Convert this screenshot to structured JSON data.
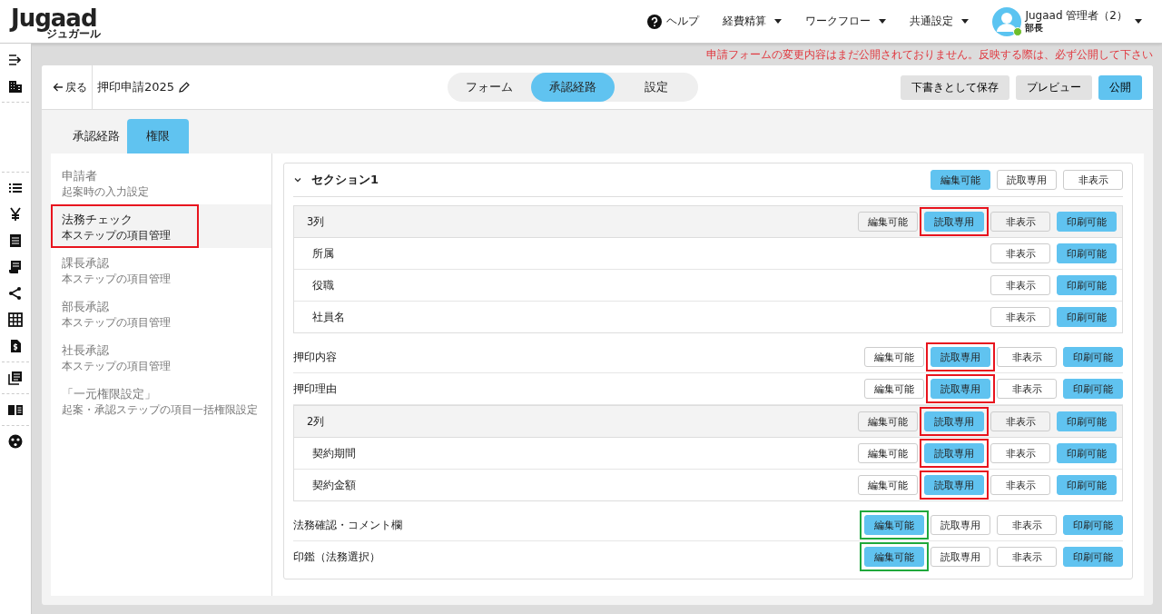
{
  "header": {
    "logo": "Jugaad",
    "logo_sub": "ジュガール",
    "help": "ヘルプ",
    "menus": [
      "経費精算",
      "ワークフロー",
      "共通設定"
    ],
    "user_name": "Jugaad 管理者（2）",
    "user_role": "部長",
    "online": true
  },
  "notice": "申請フォームの変更内容はまだ公開されておりません。反映する際は、必ず公開して下さい",
  "toolbar": {
    "back": "戻る",
    "title": "押印申請2025",
    "segments": [
      {
        "label": "フォーム",
        "selected": false
      },
      {
        "label": "承認経路",
        "selected": true
      },
      {
        "label": "設定",
        "selected": false
      }
    ],
    "buttons": [
      {
        "label": "下書きとして保存",
        "kind": "secondary"
      },
      {
        "label": "プレビュー",
        "kind": "secondary"
      },
      {
        "label": "公開",
        "kind": "primary"
      }
    ]
  },
  "tabs": [
    {
      "label": "承認経路",
      "selected": false
    },
    {
      "label": "権限",
      "selected": true
    }
  ],
  "steps": [
    {
      "title": "申請者",
      "subtitle": "起案時の入力設定",
      "selected": false
    },
    {
      "title": "法務チェック",
      "subtitle": "本ステップの項目管理",
      "selected": true,
      "color": "#e8141e"
    },
    {
      "title": "課長承認",
      "subtitle": "本ステップの項目管理",
      "selected": false
    },
    {
      "title": "部長承認",
      "subtitle": "本ステップの項目管理",
      "selected": false
    },
    {
      "title": "社長承認",
      "subtitle": "本ステップの項目管理",
      "selected": false
    },
    {
      "title": "「一元権限設定」",
      "subtitle": "起案・承認ステップの項目一括権限設定",
      "selected": false
    }
  ],
  "section": {
    "title": "セクション1",
    "expanded": true,
    "buttons": [
      {
        "label": "編集可能",
        "selected": true
      },
      {
        "label": "読取専用",
        "selected": false
      },
      {
        "label": "非表示",
        "selected": false
      }
    ],
    "rows": [
      {
        "kind": "group",
        "label": "3列",
        "buttons": [
          {
            "label": "編集可能",
            "selected": false
          },
          {
            "label": "読取専用",
            "selected": true,
            "color": "#e8141e"
          },
          {
            "label": "非表示",
            "selected": false
          },
          {
            "label": "印刷可能",
            "selected": true
          }
        ],
        "children": [
          {
            "label": "所属",
            "buttons": [
              {
                "label": "非表示",
                "selected": false
              },
              {
                "label": "印刷可能",
                "selected": true
              }
            ]
          },
          {
            "label": "役職",
            "buttons": [
              {
                "label": "非表示",
                "selected": false
              },
              {
                "label": "印刷可能",
                "selected": true
              }
            ]
          },
          {
            "label": "社員名",
            "buttons": [
              {
                "label": "非表示",
                "selected": false
              },
              {
                "label": "印刷可能",
                "selected": true
              }
            ]
          }
        ]
      },
      {
        "kind": "field",
        "label": "押印内容",
        "buttons": [
          {
            "label": "編集可能",
            "selected": false
          },
          {
            "label": "読取専用",
            "selected": true,
            "color": "#e8141e"
          },
          {
            "label": "非表示",
            "selected": false
          },
          {
            "label": "印刷可能",
            "selected": true
          }
        ]
      },
      {
        "kind": "field",
        "label": "押印理由",
        "buttons": [
          {
            "label": "編集可能",
            "selected": false
          },
          {
            "label": "読取専用",
            "selected": true,
            "color": "#e8141e"
          },
          {
            "label": "非表示",
            "selected": false
          },
          {
            "label": "印刷可能",
            "selected": true
          }
        ]
      },
      {
        "kind": "group",
        "label": "2列",
        "buttons": [
          {
            "label": "編集可能",
            "selected": false
          },
          {
            "label": "読取専用",
            "selected": true,
            "color": "#e8141e"
          },
          {
            "label": "非表示",
            "selected": false
          },
          {
            "label": "印刷可能",
            "selected": true
          }
        ],
        "children": [
          {
            "label": "契約期間",
            "buttons": [
              {
                "label": "編集可能",
                "selected": false
              },
              {
                "label": "読取専用",
                "selected": true,
                "color": "#e8141e"
              },
              {
                "label": "非表示",
                "selected": false
              },
              {
                "label": "印刷可能",
                "selected": true
              }
            ]
          },
          {
            "label": "契約金額",
            "buttons": [
              {
                "label": "編集可能",
                "selected": false
              },
              {
                "label": "読取専用",
                "selected": true,
                "color": "#e8141e"
              },
              {
                "label": "非表示",
                "selected": false
              },
              {
                "label": "印刷可能",
                "selected": true
              }
            ]
          }
        ]
      },
      {
        "kind": "field",
        "label": "法務確認・コメント欄",
        "buttons": [
          {
            "label": "編集可能",
            "selected": true,
            "color": "#1fa83c"
          },
          {
            "label": "読取専用",
            "selected": false
          },
          {
            "label": "非表示",
            "selected": false
          },
          {
            "label": "印刷可能",
            "selected": true
          }
        ]
      },
      {
        "kind": "field",
        "label": "印鑑（法務選択）",
        "buttons": [
          {
            "label": "編集可能",
            "selected": true,
            "color": "#1fa83c"
          },
          {
            "label": "読取専用",
            "selected": false
          },
          {
            "label": "非表示",
            "selected": false
          },
          {
            "label": "印刷可能",
            "selected": true
          }
        ]
      }
    ]
  }
}
